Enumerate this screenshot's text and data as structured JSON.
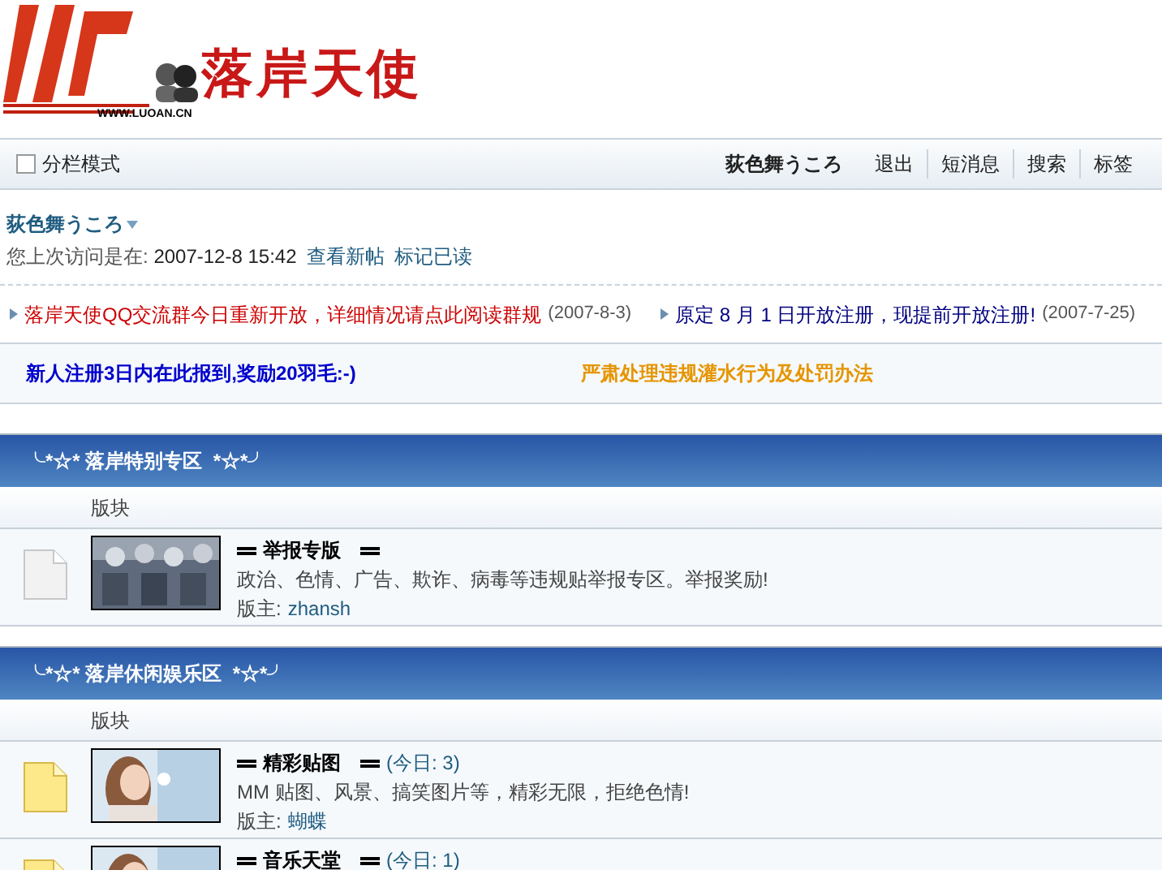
{
  "logo": {
    "title": "落岸天使",
    "url": "WWW.LUOAN.CN"
  },
  "toolbar": {
    "split_mode": {
      "label": "分栏模式",
      "checked": false
    },
    "user": "荻色舞うころ",
    "links": [
      "退出",
      "短消息",
      "搜索",
      "标签"
    ]
  },
  "user_panel": {
    "name": "荻色舞うころ",
    "last_visit_label": "您上次访问是在:",
    "last_visit": "2007-12-8 15:42",
    "links": [
      "查看新帖",
      "标记已读"
    ]
  },
  "announcements": [
    {
      "title": "落岸天使QQ交流群今日重新开放，详细情况请点此阅读群规",
      "date": "(2007-8-3)",
      "color": "#cc0000"
    },
    {
      "title": "原定  8 月  1 日开放注册，现提前开放注册!",
      "date": "(2007-7-25)",
      "color": "#000080"
    }
  ],
  "notices": [
    {
      "text": "新人注册3日内在此报到,奖励20羽毛:-)",
      "color": "#0000cc"
    },
    {
      "text": "严肃处理违规灌水行为及处罚办法",
      "color": "#e69500"
    }
  ],
  "categories": [
    {
      "title": "╰*☆* 落岸特别专区  *☆*╯",
      "column": "版块",
      "forums": [
        {
          "name": "举报专版",
          "description": "政治、色情、广告、欺诈、病毒等违规贴举报专区。举报奖励!",
          "moderator_label": "版主:",
          "moderator": "zhansh",
          "new_posts": false
        }
      ]
    },
    {
      "title": "╰*☆* 落岸休闲娱乐区  *☆*╯",
      "column": "版块",
      "forums": [
        {
          "name": "精彩贴图",
          "today": "(今日: 3)",
          "description": "MM 贴图、风景、搞笑图片等，精彩无限，拒绝色情!",
          "moderator_label": "版主:",
          "moderator": "蝴蝶",
          "new_posts": true
        },
        {
          "name": "音乐天堂",
          "today": "(今日: 1)",
          "new_posts": true
        }
      ]
    }
  ]
}
